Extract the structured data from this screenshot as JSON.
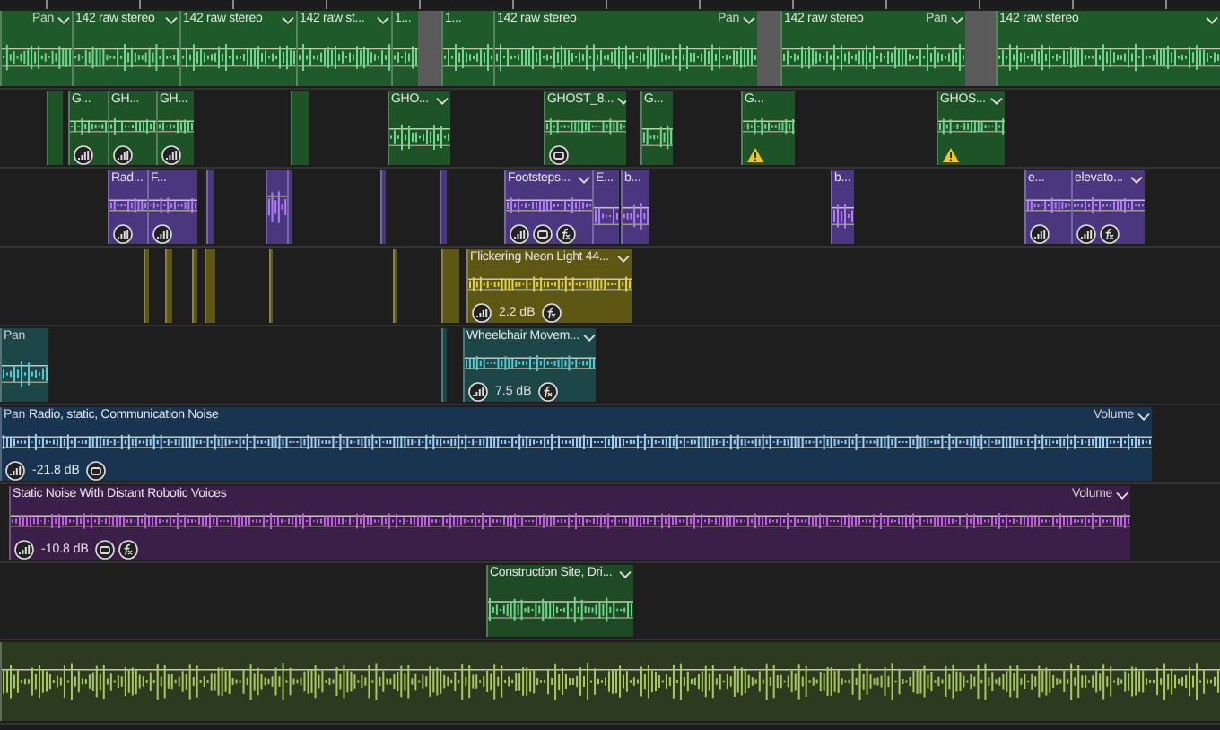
{
  "tracks": [
    {
      "color": "#1f5a2a",
      "clips": [
        {
          "tail": "Pan"
        },
        {
          "label": "142 raw stereo"
        },
        {
          "label": "142 raw stereo"
        },
        {
          "label": "142 raw st..."
        },
        {
          "label": "1..."
        },
        {
          "label": "1..."
        },
        {
          "label": "142 raw stereo",
          "tail": "Pan"
        },
        {
          "label": "142 raw stereo",
          "tail": "Pan"
        },
        {
          "label": "142 raw stereo"
        }
      ]
    },
    {
      "color": "#1d5327",
      "clips": [
        {
          "label": "G...",
          "warning": false
        },
        {
          "label": "GH...",
          "warning": false
        },
        {
          "label": "GH...",
          "warning": false
        },
        {
          "label": "GHO...",
          "warning": false
        },
        {
          "label": "GHOST_8...",
          "warning": false
        },
        {
          "label": "G...",
          "warning": false
        },
        {
          "label": "G...",
          "warning": true
        },
        {
          "label": "GHOS...",
          "warning": true
        }
      ]
    },
    {
      "color": "#4b3680",
      "clips": [
        {
          "label": "Rad..."
        },
        {
          "label": "F..."
        },
        {
          "label": "Footsteps..."
        },
        {
          "label": "E..."
        },
        {
          "label": "b..."
        },
        {
          "label": "b..."
        },
        {
          "label": "e..."
        },
        {
          "label": "elevato..."
        }
      ]
    },
    {
      "color": "#5e5714",
      "clips": [
        {
          "label": "Flickering Neon Light 44...",
          "gain": "2.2 dB"
        }
      ]
    },
    {
      "color": "#1c4648",
      "clips": [
        {
          "lead": "Pan"
        },
        {
          "label": "Wheelchair Movem...",
          "gain": "7.5 dB"
        }
      ]
    },
    {
      "color": "#183450",
      "clips": [
        {
          "lead": "Pan",
          "label": "Radio, static, Communication Noise",
          "gain": "-21.8 dB",
          "tail": "Volume"
        }
      ]
    },
    {
      "color": "#3b1f48",
      "clips": [
        {
          "label": "Static Noise With Distant Robotic Voices",
          "gain": "-10.8 dB",
          "tail": "Volume"
        }
      ]
    },
    {
      "color": "#1e4a26",
      "clips": [
        {
          "label": "Construction Site, Dri..."
        }
      ]
    },
    {
      "color": "#2c3a20"
    }
  ]
}
